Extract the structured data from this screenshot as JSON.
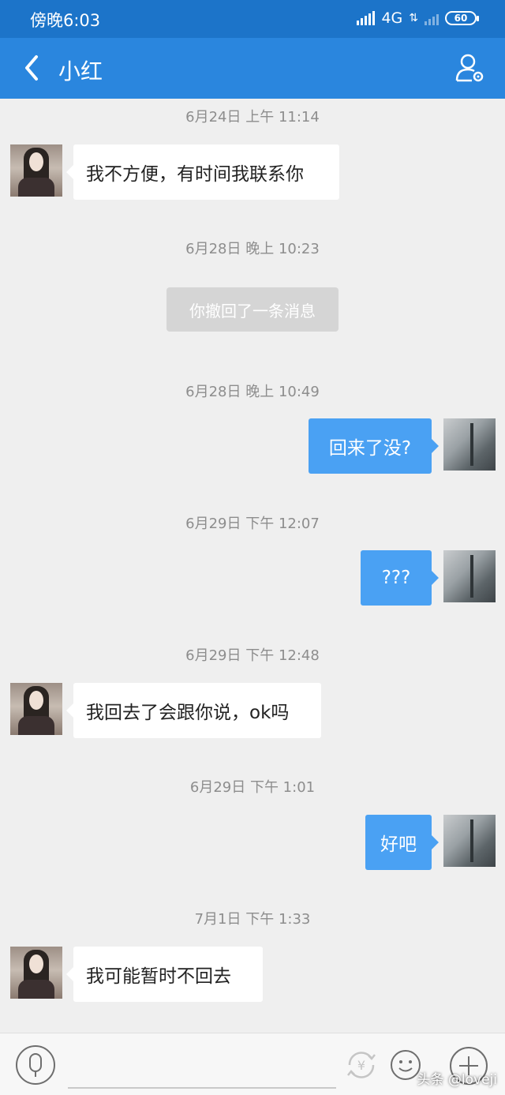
{
  "status_bar": {
    "time": "傍晚6:03",
    "network": "4G",
    "battery": "60"
  },
  "header": {
    "title": "小红"
  },
  "messages": [
    {
      "time": "6月24日 上午 11:14",
      "text": "我不方便，有时间我联系你"
    },
    {
      "time": "6月28日 晚上 10:23",
      "text": "你撤回了一条消息"
    },
    {
      "time": "6月28日 晚上 10:49",
      "text": "回来了没?"
    },
    {
      "time": "6月29日 下午 12:07",
      "text": "???"
    },
    {
      "time": "6月29日 下午 12:48",
      "text": "我回去了会跟你说，ok吗"
    },
    {
      "time": "6月29日 下午 1:01",
      "text": "好吧"
    },
    {
      "time": "7月1日 下午 1:33",
      "text": "我可能暂时不回去"
    }
  ],
  "watermark": "头条 @loveji",
  "colors": {
    "header": "#2a86de",
    "status_bar": "#1c74c9",
    "outgoing_bubble": "#4aa1f3",
    "background": "#efefef"
  }
}
